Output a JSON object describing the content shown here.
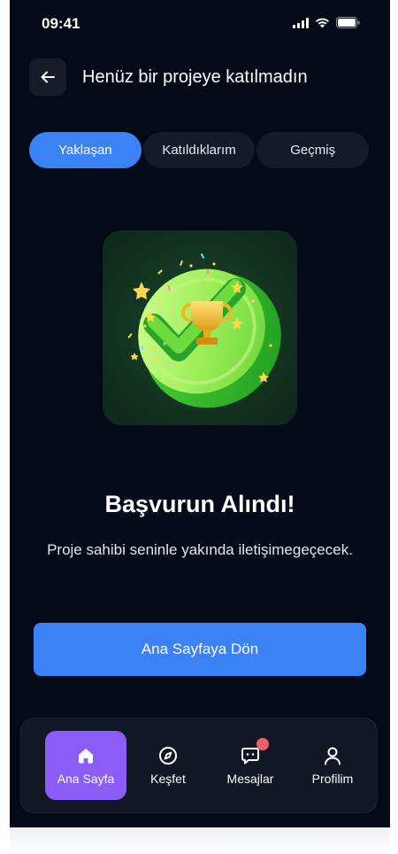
{
  "status_bar": {
    "time": "09:41"
  },
  "header": {
    "title": "Henüz bir projeye katılmadın",
    "back_icon": "arrow-left-icon"
  },
  "tabs": [
    {
      "label": "Yaklaşan",
      "active": true
    },
    {
      "label": "Katıldıklarım",
      "active": false
    },
    {
      "label": "Geçmiş",
      "active": false
    }
  ],
  "success": {
    "title": "Başvurun Alındı!",
    "subtitle": "Proje sahibi seninle yakında iletişimegeçecek.",
    "illustration": "green-checkmark-trophy-icon"
  },
  "cta": {
    "label": "Ana Sayfaya Dön"
  },
  "bottom_nav": {
    "items": [
      {
        "label": "Ana Sayfa",
        "icon": "home-icon",
        "active": true
      },
      {
        "label": "Keşfet",
        "icon": "compass-icon",
        "active": false
      },
      {
        "label": "Mesajlar",
        "icon": "message-icon",
        "active": false,
        "notification": true
      },
      {
        "label": "Profilim",
        "icon": "user-icon",
        "active": false
      }
    ]
  },
  "colors": {
    "background": "#050a19",
    "primary": "#3b82f6",
    "nav_active": "#8b5cf6",
    "notification": "#f0606a",
    "surface": "#151a29"
  }
}
